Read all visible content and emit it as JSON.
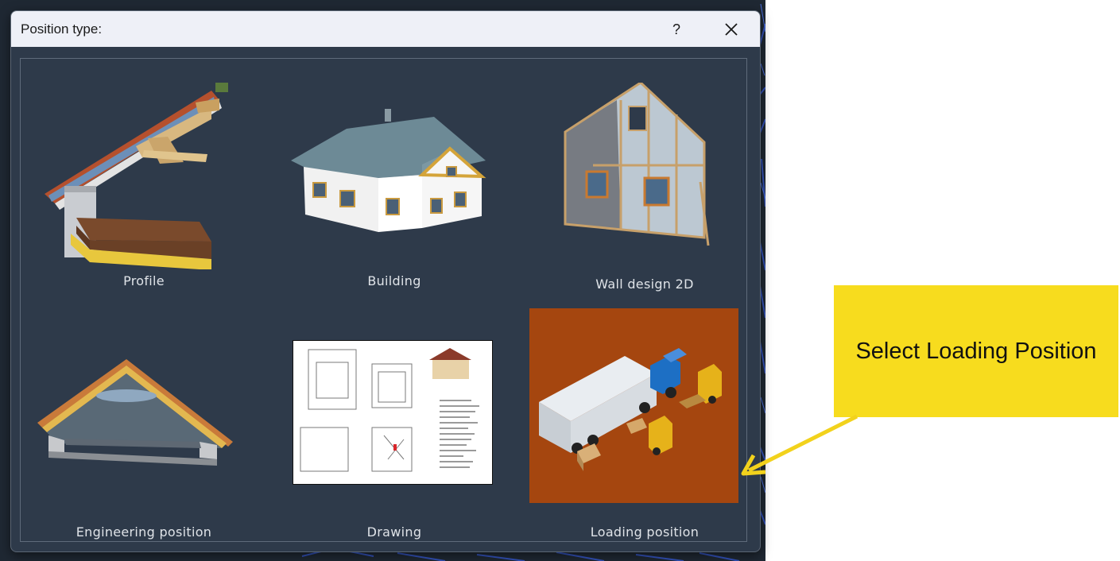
{
  "dialog": {
    "title": "Position type:",
    "help_label": "?",
    "close_icon": "close-icon"
  },
  "options": [
    {
      "label": "Profile",
      "icon": "roof-profile-image"
    },
    {
      "label": "Building",
      "icon": "house-3d-image"
    },
    {
      "label": "Wall design 2D",
      "icon": "wall-frame-image"
    },
    {
      "label": "Engineering position",
      "icon": "roof-truss-image"
    },
    {
      "label": "Drawing",
      "icon": "floor-plan-drawing-image"
    },
    {
      "label": "Loading position",
      "icon": "truck-forklift-image",
      "selected": true
    }
  ],
  "callout": {
    "text": "Select Loading Position",
    "color": "#f7dc1e"
  },
  "colors": {
    "dialog_bg": "#2e3a4a",
    "titlebar_bg": "#eef0f7",
    "selected_tile_bg": "#a5460f"
  }
}
